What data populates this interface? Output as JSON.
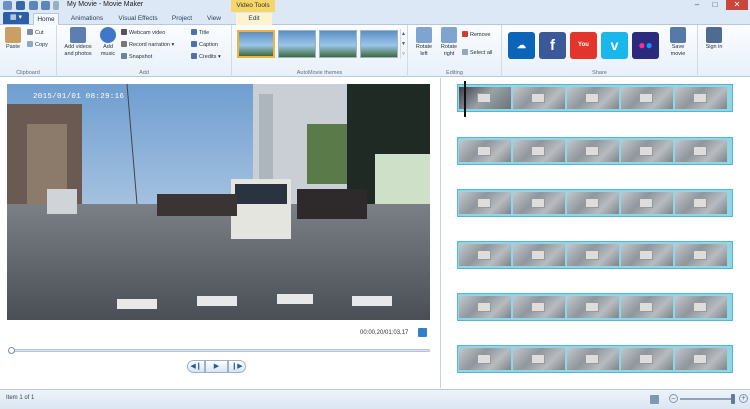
{
  "window": {
    "title": "My Movie - Movie Maker",
    "contextual_tab": "Video Tools",
    "minimize": "–",
    "maximize": "□",
    "close": "✕"
  },
  "tabs": [
    {
      "label": "Home",
      "active": true
    },
    {
      "label": "Animations"
    },
    {
      "label": "Visual Effects"
    },
    {
      "label": "Project"
    },
    {
      "label": "View"
    },
    {
      "label": "Edit"
    }
  ],
  "ribbon": {
    "clipboard": {
      "label": "Clipboard",
      "paste": "Paste",
      "cut": "Cut",
      "copy": "Copy"
    },
    "add": {
      "label": "Add",
      "add_videos": "Add videos and photos",
      "add_music": "Add music",
      "webcam": "Webcam video",
      "narration": "Record narration",
      "snapshot": "Snapshot",
      "title": "Title",
      "caption": "Caption",
      "credits": "Credits"
    },
    "themes": {
      "label": "AutoMovie themes",
      "count": 4
    },
    "editing": {
      "label": "Editing",
      "rotate_left": "Rotate left",
      "rotate_right": "Rotate right",
      "remove": "Remove",
      "select_all": "Select all"
    },
    "share": {
      "label": "Share",
      "services": [
        "onedrive-icon",
        "facebook-icon",
        "youtube-icon",
        "vimeo-icon",
        "flickr-icon"
      ],
      "save_movie": "Save movie",
      "sign_in": "Sign in"
    }
  },
  "preview": {
    "timestamp_overlay": "2015/01/01 08:29:16",
    "timecode": "00:00,20/01:03,17",
    "progress": 0.0,
    "controls": {
      "prev": "◀❙",
      "play": "▶",
      "next": "❙▶"
    }
  },
  "storyboard": {
    "strips": 6,
    "frames_per_strip": 5
  },
  "status": {
    "text": "Item 1 of 1"
  },
  "colors": {
    "accent": "#2b5ea7",
    "contextual": "#f6d66a",
    "selection": "#8fd6e6",
    "close": "#c8463a"
  }
}
